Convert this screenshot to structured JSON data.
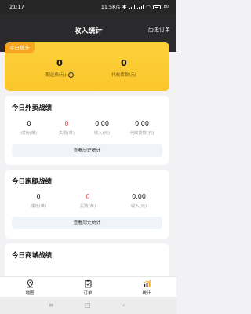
{
  "status_bar": {
    "time": "21:17",
    "network_speed": "11.5K/s",
    "battery": "80"
  },
  "header": {
    "title": "收入统计",
    "history_link": "历史订单"
  },
  "today_summary": {
    "tag": "今日统计",
    "delivery_fee_value": "0",
    "delivery_fee_label": "配送费(元)",
    "collection_value": "0",
    "collection_label": "代收货款(元)"
  },
  "takeout": {
    "title": "今日外卖战绩",
    "stats": [
      {
        "value": "0",
        "label": "成功(单)"
      },
      {
        "value": "0",
        "label": "失败(单)"
      },
      {
        "value": "0.00",
        "label": "收入(元)"
      },
      {
        "value": "0.00",
        "label": "代收货款(元)"
      }
    ],
    "button": "查看历史统计"
  },
  "errand": {
    "title": "今日跑腿战绩",
    "stats": [
      {
        "value": "0",
        "label": "成功(单)"
      },
      {
        "value": "0",
        "label": "失败(单)"
      },
      {
        "value": "0.00",
        "label": "收入(元)"
      }
    ],
    "button": "查看历史统计"
  },
  "mall": {
    "title": "今日商城战绩"
  },
  "tabs": [
    {
      "label": "地图",
      "icon": "map-pin-icon"
    },
    {
      "label": "订单",
      "icon": "clipboard-icon"
    },
    {
      "label": "统计",
      "icon": "bar-chart-icon"
    }
  ],
  "colors": {
    "header_bg": "#2a2a2c",
    "summary_yellow": "#fbc62b",
    "tag_orange": "#f6a623",
    "fail_red": "#e64545"
  }
}
